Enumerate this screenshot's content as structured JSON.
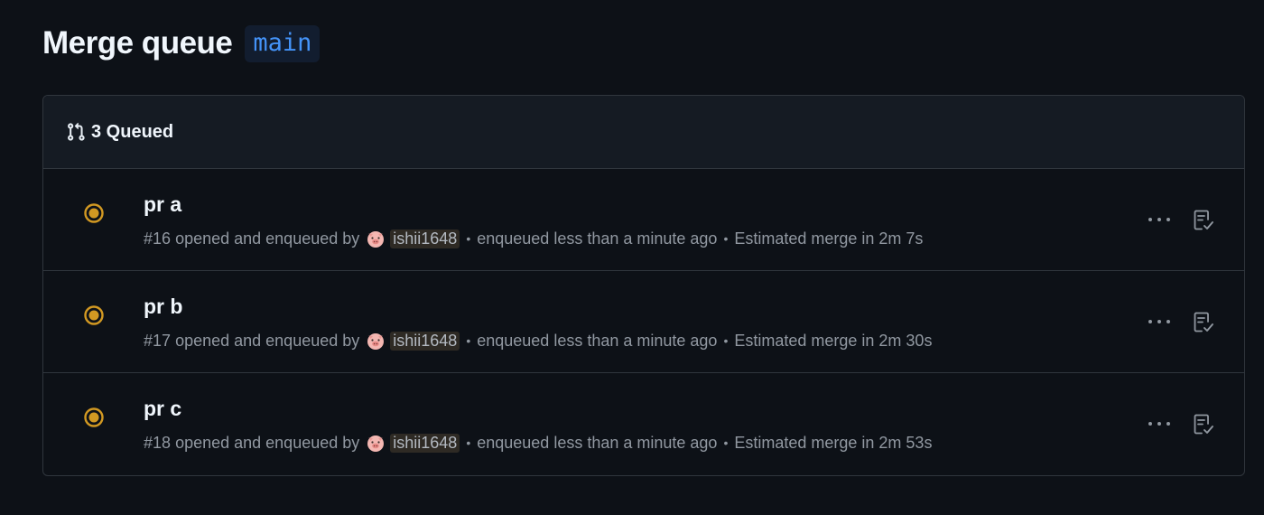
{
  "header": {
    "title": "Merge queue",
    "branch": "main"
  },
  "queue": {
    "count_label": "3 Queued",
    "items": [
      {
        "title": "pr a",
        "number": "#16",
        "action": "opened and enqueued by",
        "user": "ishii1648",
        "enqueued": "enqueued less than a minute ago",
        "estimate": "Estimated merge in 2m 7s"
      },
      {
        "title": "pr b",
        "number": "#17",
        "action": "opened and enqueued by",
        "user": "ishii1648",
        "enqueued": "enqueued less than a minute ago",
        "estimate": "Estimated merge in 2m 30s"
      },
      {
        "title": "pr c",
        "number": "#18",
        "action": "opened and enqueued by",
        "user": "ishii1648",
        "enqueued": "enqueued less than a minute ago",
        "estimate": "Estimated merge in 2m 53s"
      }
    ],
    "separator": "•"
  },
  "colors": {
    "background": "#0d1117",
    "header_bg": "#151b23",
    "border": "#30363d",
    "accent": "#4493f8",
    "status_pending": "#d29922",
    "muted_text": "#9198a1"
  },
  "icons": {
    "header": "git-pull-request-icon",
    "status": "pending-dot-icon",
    "more": "kebab-horizontal-icon",
    "checks": "checklist-icon",
    "avatar": "pig-avatar-icon"
  }
}
